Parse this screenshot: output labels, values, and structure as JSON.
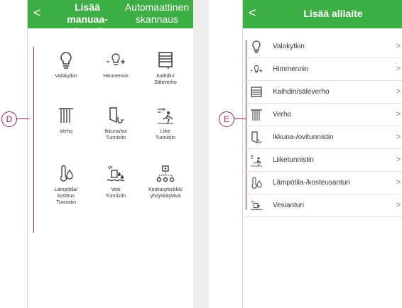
{
  "left_screen": {
    "back_label": "<",
    "tab_manual": "Lisää manuaa-",
    "tab_manual_line2": "lisesti",
    "tab_auto": "Automaattinen",
    "tab_auto_line2": "skannaus",
    "callout": "D",
    "devices": [
      {
        "label": "Valokytkin",
        "icon": "lightbulb-icon"
      },
      {
        "label": "Himmennin",
        "icon": "dimmer-icon"
      },
      {
        "label": "Kaihdin/\nSäleverho",
        "icon": "blind-icon"
      },
      {
        "label": "Verho",
        "icon": "curtain-icon"
      },
      {
        "label": "Ikkuna/ovi\nTunnistin",
        "icon": "window-door-sensor-icon"
      },
      {
        "label": "Liike\nTunnistin",
        "icon": "motion-sensor-icon"
      },
      {
        "label": "Lämpötila/\nkosteus\nTunnistin",
        "icon": "temperature-humidity-icon"
      },
      {
        "label": "Vesi\nTunnistin",
        "icon": "water-sensor-icon"
      },
      {
        "label": "Keskusyksikkö/\nyhdyskäytävä",
        "icon": "hub-gateway-icon"
      }
    ]
  },
  "right_screen": {
    "back_label": "<",
    "title": "Lisää alilaite",
    "callout": "E",
    "chevron": ">",
    "items": [
      {
        "label": "Valokytkin",
        "icon": "lightbulb-icon"
      },
      {
        "label": "Himmennin",
        "icon": "dimmer-icon"
      },
      {
        "label": "Kaihdin/säleverho",
        "icon": "blind-icon"
      },
      {
        "label": "Verho",
        "icon": "curtain-icon"
      },
      {
        "label": "Ikkuna-/ovitunnistin",
        "icon": "window-door-sensor-icon"
      },
      {
        "label": "Liiketunnistin",
        "icon": "motion-sensor-icon"
      },
      {
        "label": "Lämpötila-/kosteusanturi",
        "icon": "temperature-humidity-icon"
      },
      {
        "label": "Vesianturi",
        "icon": "water-sensor-icon"
      }
    ]
  },
  "colors": {
    "header_green": "#3dae44",
    "callout_magenta": "#a01d4e"
  }
}
